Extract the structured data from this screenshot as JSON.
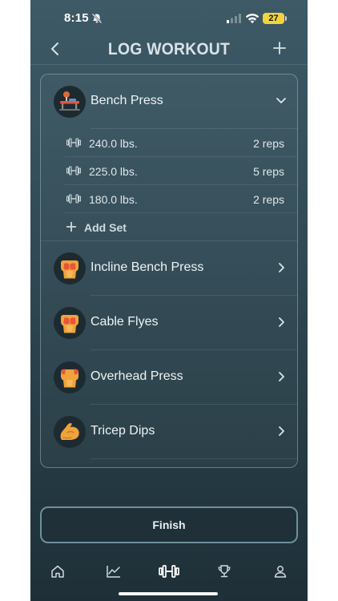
{
  "status_bar": {
    "time": "8:15",
    "battery": "27"
  },
  "nav": {
    "title": "LOG WORKOUT"
  },
  "exercises": [
    {
      "name": "Bench Press",
      "expanded": true,
      "sets": [
        {
          "weight": "240.0 lbs.",
          "reps": "2 reps"
        },
        {
          "weight": "225.0 lbs.",
          "reps": "5 reps"
        },
        {
          "weight": "180.0 lbs.",
          "reps": "2 reps"
        }
      ],
      "add_set_label": "Add Set"
    },
    {
      "name": "Incline Bench Press",
      "expanded": false
    },
    {
      "name": "Cable Flyes",
      "expanded": false
    },
    {
      "name": "Overhead Press",
      "expanded": false
    },
    {
      "name": "Tricep Dips",
      "expanded": false
    }
  ],
  "finish_label": "Finish",
  "tabs": [
    {
      "icon": "home-icon",
      "active": false
    },
    {
      "icon": "chart-icon",
      "active": false
    },
    {
      "icon": "dumbbell-icon",
      "active": true
    },
    {
      "icon": "trophy-icon",
      "active": false
    },
    {
      "icon": "profile-icon",
      "active": false
    }
  ],
  "colors": {
    "background_top": "#3d5a66",
    "background_bottom": "#1e2f37",
    "battery": "#f2d33b",
    "accent_orange": "#f0a33a"
  }
}
